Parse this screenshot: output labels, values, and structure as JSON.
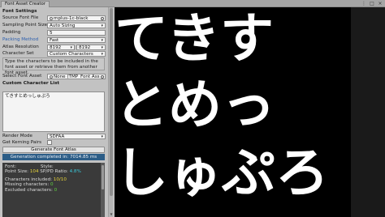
{
  "window": {
    "tab_title": "Font Asset Creator",
    "menu_icon": "kebab-menu-icon",
    "maximize_icon": "maximize-icon",
    "close_icon": "close-icon"
  },
  "settings": {
    "header": "Font Settings",
    "source_font_file": {
      "label": "Source Font File",
      "value": "mplus-1c-black"
    },
    "sampling_point_size": {
      "label": "Sampling Point Size",
      "value": "Auto Sizing"
    },
    "padding": {
      "label": "Padding",
      "value": "5"
    },
    "packing_method": {
      "label": "Packing Method",
      "value": "Fast"
    },
    "atlas_resolution": {
      "label": "Atlas Resolution",
      "width": "8192",
      "height": "8192"
    },
    "character_set": {
      "label": "Character Set",
      "value": "Custom Characters"
    },
    "help_text": "Type the characters to be included in the font asset or retrieve them from another font asset.",
    "select_font_asset": {
      "label": "Select Font Asset",
      "value": "None (TMP_Font Ass"
    },
    "custom_character_list": {
      "label": "Custom Character List",
      "value": "てきすとめっしゅぷろ"
    },
    "render_mode": {
      "label": "Render Mode",
      "value": "SDFAA"
    },
    "get_kerning_pairs": {
      "label": "Get Kerning Pairs",
      "checked": false
    }
  },
  "actions": {
    "generate_label": "Generate Font Atlas"
  },
  "status": {
    "text": "Generation completed in: 7014.85 ms"
  },
  "output": {
    "font_label": "Font:",
    "style_label": "Style:",
    "point_size_label": "Point Size:",
    "point_size_value": "104",
    "sp_pd_label": "SP/PD Ratio:",
    "sp_pd_value": "4.8%",
    "included_label": "Characters included:",
    "included_value": "10/10",
    "missing_label": "Missing characters:",
    "missing_value": "0",
    "excluded_label": "Excluded characters:",
    "excluded_value": "0"
  },
  "preview": {
    "lines": [
      "てきす",
      "とめっ",
      "しゅぷろ"
    ]
  },
  "colors": {
    "status_bar": "#2c5d87",
    "preview_bg": "#000000",
    "accent_label": "#2c5fae",
    "output_yellow": "#e6d23a",
    "output_green": "#5fd03f",
    "output_cyan": "#3ac9dc"
  }
}
